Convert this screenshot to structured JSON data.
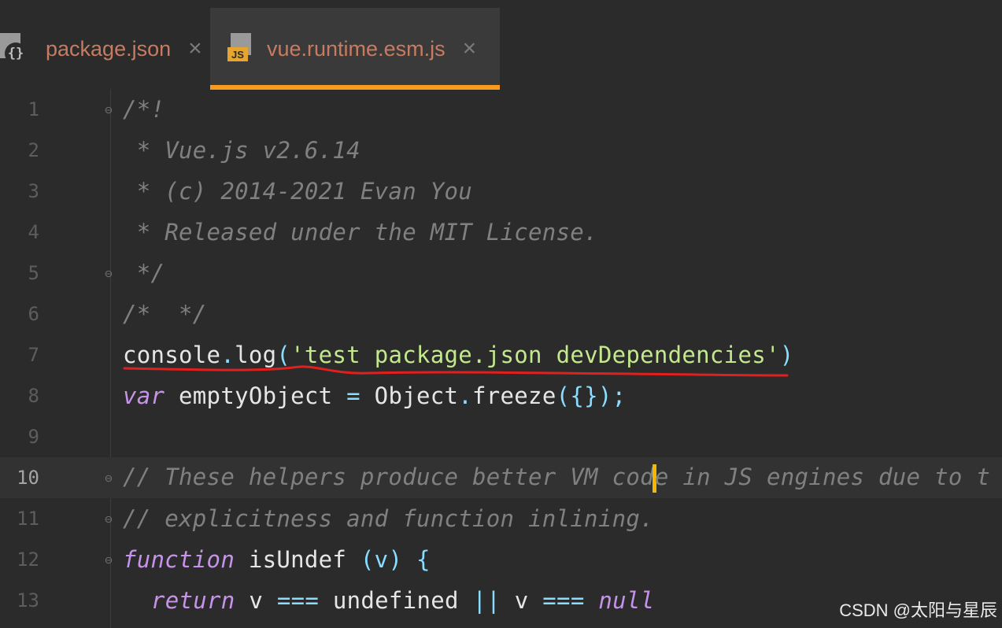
{
  "tabs": [
    {
      "label": "package.json",
      "icon": "json-file-icon",
      "icon_badge": "{}",
      "close": "×",
      "active": false
    },
    {
      "label": "vue.runtime.esm.js",
      "icon": "js-file-icon",
      "icon_badge": "JS",
      "close": "×",
      "active": true
    }
  ],
  "editor": {
    "current_line": 10,
    "line_numbers": [
      "1",
      "2",
      "3",
      "4",
      "5",
      "6",
      "7",
      "8",
      "9",
      "10",
      "11",
      "12",
      "13"
    ],
    "lines": {
      "l1": "/*!",
      "l2": " * Vue.js v2.6.14",
      "l3": " * (c) 2014-2021 Evan You",
      "l4": " * Released under the MIT License.",
      "l5": " */",
      "l6": "/*  */",
      "l7": {
        "obj": "console",
        "dot": ".",
        "fn": "log",
        "open": "(",
        "str": "'test package.json devDependencies'",
        "close": ")"
      },
      "l8": {
        "kw": "var",
        "name": " emptyObject ",
        "eq": "=",
        "obj": " Object",
        "dot": ".",
        "fn": "freeze",
        "args": "({});"
      },
      "l9": "",
      "l10": {
        "before": "// These helpers produce better VM cod",
        "after": "e in JS engines due to t"
      },
      "l11": "// explicitness and function inlining.",
      "l12": {
        "kw": "function",
        "name": " isUndef ",
        "args": "(v) {"
      },
      "l13": {
        "kw": "return",
        "a": " v ",
        "op1": "===",
        "b": " undefined ",
        "op2": "||",
        "c": " v ",
        "op3": "===",
        "d": " ",
        "null": "null"
      }
    }
  },
  "annotation": {
    "color": "#e0201e",
    "target_line": 7
  },
  "colors": {
    "tab_accent": "#f79a1e",
    "caret": "#f5b800",
    "comment": "#808080",
    "keyword": "#c792ea",
    "string": "#c3e88d",
    "punctuation": "#89ddff"
  },
  "watermark": "CSDN @太阳与星辰"
}
